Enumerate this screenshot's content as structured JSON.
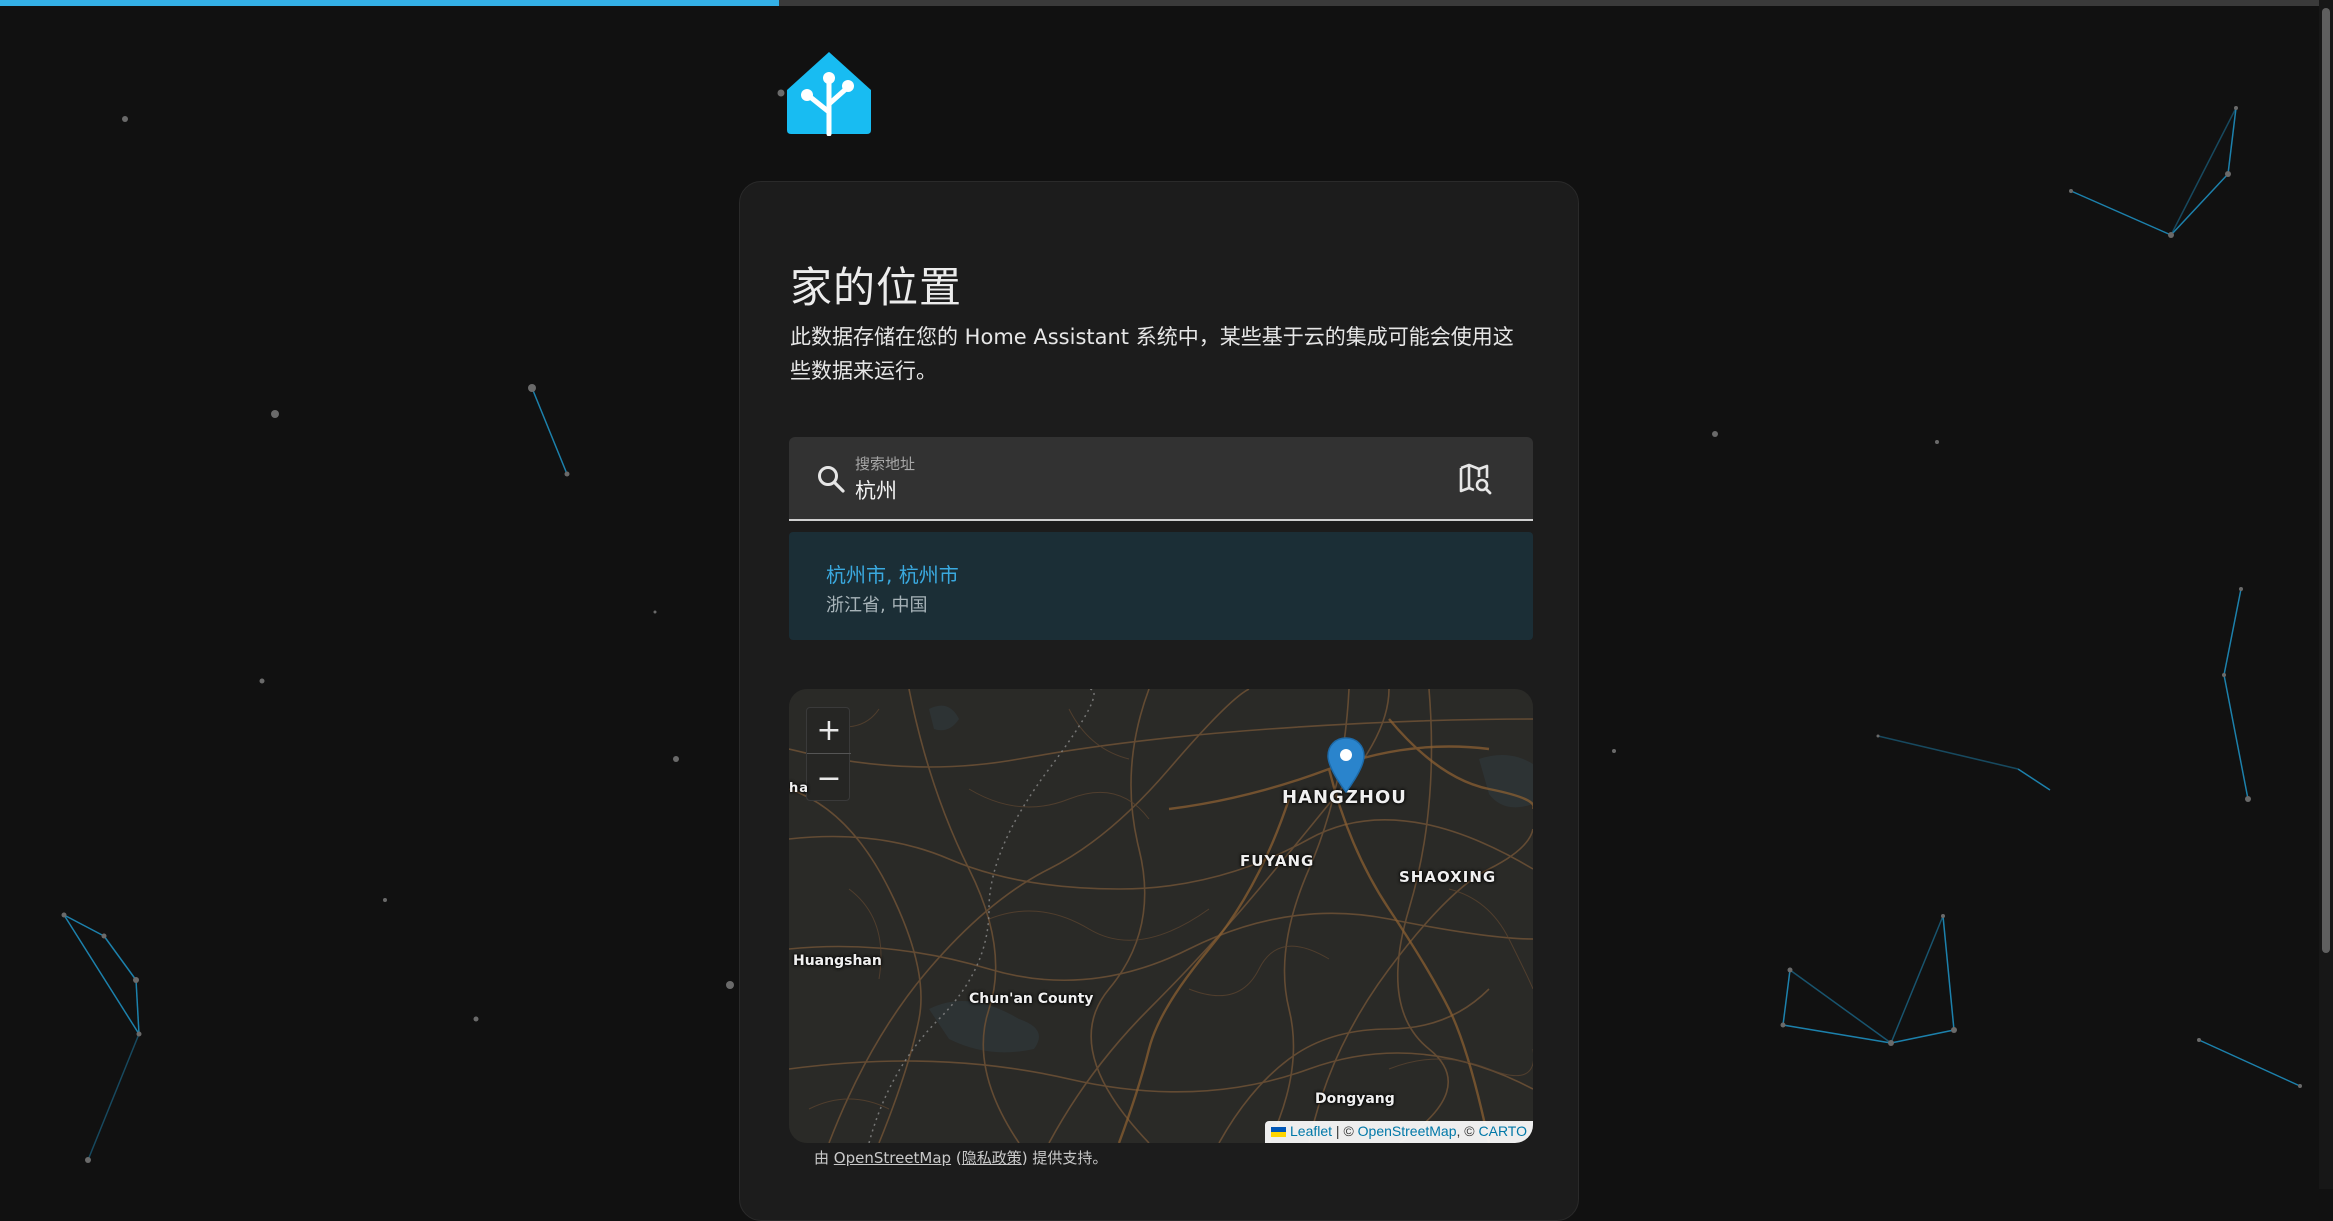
{
  "progress": {
    "percent": 33.4,
    "color": "#34b0e6"
  },
  "logo": {
    "icon": "home-assistant-logo",
    "color": "#18bcf2"
  },
  "card": {
    "title": "家的位置",
    "description": "此数据存储在您的 Home Assistant 系统中，某些基于云的集成可能会使用这些数据来运行。"
  },
  "search": {
    "label": "搜索地址",
    "value": "杭州",
    "search_icon": "magnify-icon",
    "map_search_icon": "map-search-icon"
  },
  "results": [
    {
      "title": "杭州市, 杭州市",
      "subtitle": "浙江省, 中国"
    }
  ],
  "map": {
    "zoom_in": "+",
    "zoom_out": "−",
    "labels": {
      "hangzhou": "HANGZHOU",
      "fuyang": "FUYANG",
      "shaoxing": "SHAOXING",
      "huangshan": "Huangshan",
      "chunan": "Chun'an County",
      "dongyang": "Dongyang",
      "edge": "ha"
    },
    "attribution": {
      "leaflet": "Leaflet",
      "sep1": " | © ",
      "osm": "OpenStreetMap",
      "sep2": ", © ",
      "carto": "CARTO"
    }
  },
  "footer_note": {
    "prefix": "由 ",
    "osm": "OpenStreetMap",
    "open_paren": " (",
    "privacy": "隐私政策",
    "close_paren": ") ",
    "suffix": "提供支持。"
  }
}
